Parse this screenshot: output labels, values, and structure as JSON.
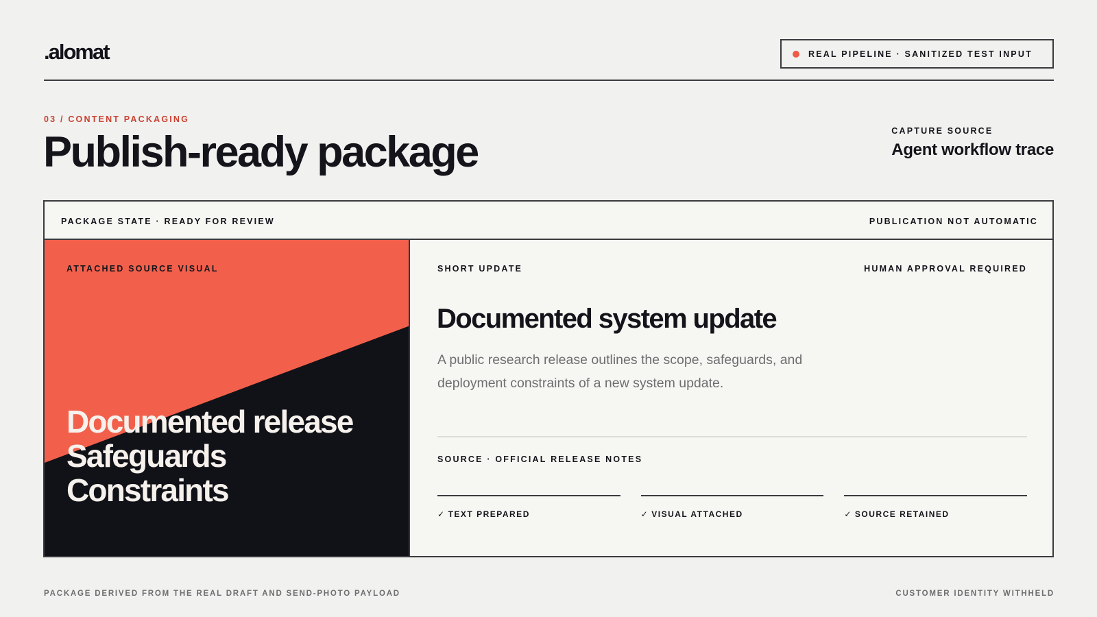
{
  "brand": {
    "logo": ".alomat"
  },
  "status_badge": {
    "text": "REAL PIPELINE · SANITIZED TEST INPUT",
    "dot_color": "#ee5a48"
  },
  "section": {
    "eyebrow": "03 / CONTENT PACKAGING",
    "title": "Publish-ready package"
  },
  "capture_source": {
    "label": "CAPTURE SOURCE",
    "value": "Agent workflow trace"
  },
  "package": {
    "state": "PACKAGE STATE · READY FOR REVIEW",
    "publication_note": "PUBLICATION NOT AUTOMATIC",
    "visual": {
      "label": "ATTACHED SOURCE VISUAL",
      "lines": [
        "Documented release",
        "Safeguards",
        "Constraints"
      ],
      "colors": {
        "accent": "#f2604c",
        "dark": "#111218"
      }
    },
    "update": {
      "kicker": "SHORT UPDATE",
      "approval": "HUMAN APPROVAL REQUIRED",
      "headline": "Documented system update",
      "summary": "A public research release outlines the scope, safeguards, and deployment constraints of a new system update.",
      "source": "SOURCE · OFFICIAL RELEASE NOTES",
      "checks": [
        {
          "mark": "✓",
          "label": "TEXT PREPARED"
        },
        {
          "mark": "✓",
          "label": "VISUAL ATTACHED"
        },
        {
          "mark": "✓",
          "label": "SOURCE RETAINED"
        }
      ]
    }
  },
  "footer": {
    "left": "PACKAGE DERIVED FROM THE REAL DRAFT AND SEND-PHOTO PAYLOAD",
    "right": "CUSTOMER IDENTITY WITHHELD"
  }
}
